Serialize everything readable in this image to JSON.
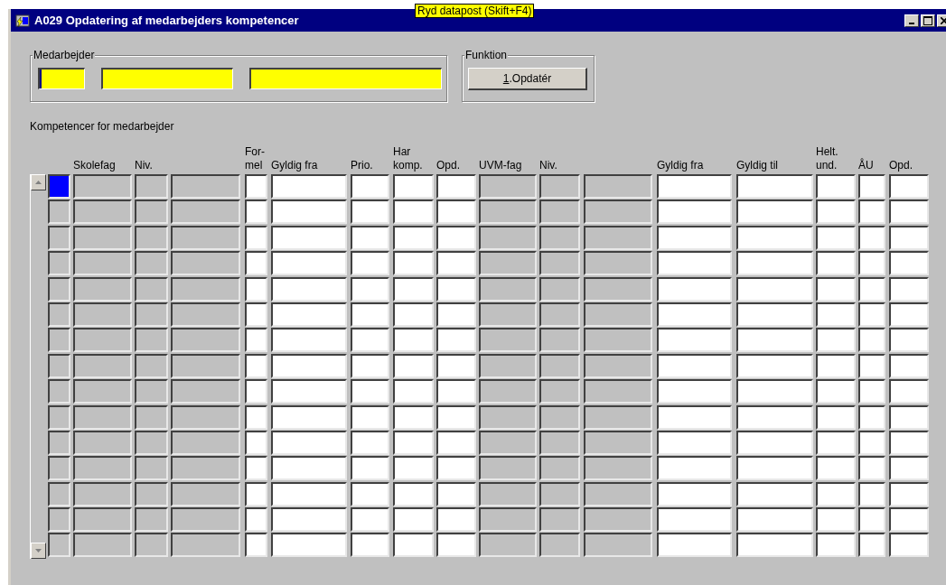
{
  "window": {
    "title": "A029 Opdatering af medarbejders kompetencer",
    "hint": "Ryd datapost (Skift+F4)"
  },
  "medarbejder": {
    "legend": "Medarbejder",
    "fields": [
      {
        "focused": true
      },
      {
        "focused": false
      },
      {
        "focused": false
      }
    ]
  },
  "funktion": {
    "legend": "Funktion",
    "button": {
      "label": "1.Opdatér",
      "mnemonic_underlined": true
    }
  },
  "table": {
    "caption": "Kompetencer for medarbejder",
    "columns": [
      {
        "header": "Skolefag",
        "editable": false
      },
      {
        "header": "Niv.",
        "editable": false
      },
      {
        "editable": false
      },
      {
        "header": "For-\nmel",
        "editable": true
      },
      {
        "header": "Gyldig fra",
        "editable": true
      },
      {
        "header": "Prio.",
        "editable": true
      },
      {
        "header": "Har\nkomp.",
        "editable": true
      },
      {
        "header": "Opd.",
        "editable": true
      },
      {
        "header": "UVM-fag",
        "editable": false
      },
      {
        "header": "Niv.",
        "editable": false
      },
      {
        "editable": false
      },
      {
        "header": "Gyldig fra",
        "editable": true
      },
      {
        "header": "Gyldig til",
        "editable": true
      },
      {
        "header": "Helt.\nund.",
        "editable": true
      },
      {
        "header": "ÅU",
        "editable": true
      },
      {
        "header": "Opd.",
        "editable": true
      }
    ],
    "rows": [
      {
        "selected": true
      },
      {
        "selected": false
      },
      {
        "selected": false
      },
      {
        "selected": false
      },
      {
        "selected": false
      },
      {
        "selected": false
      },
      {
        "selected": false
      },
      {
        "selected": false
      },
      {
        "selected": false
      },
      {
        "selected": false
      },
      {
        "selected": false
      },
      {
        "selected": false
      },
      {
        "selected": false
      },
      {
        "selected": false
      },
      {
        "selected": false
      }
    ]
  }
}
